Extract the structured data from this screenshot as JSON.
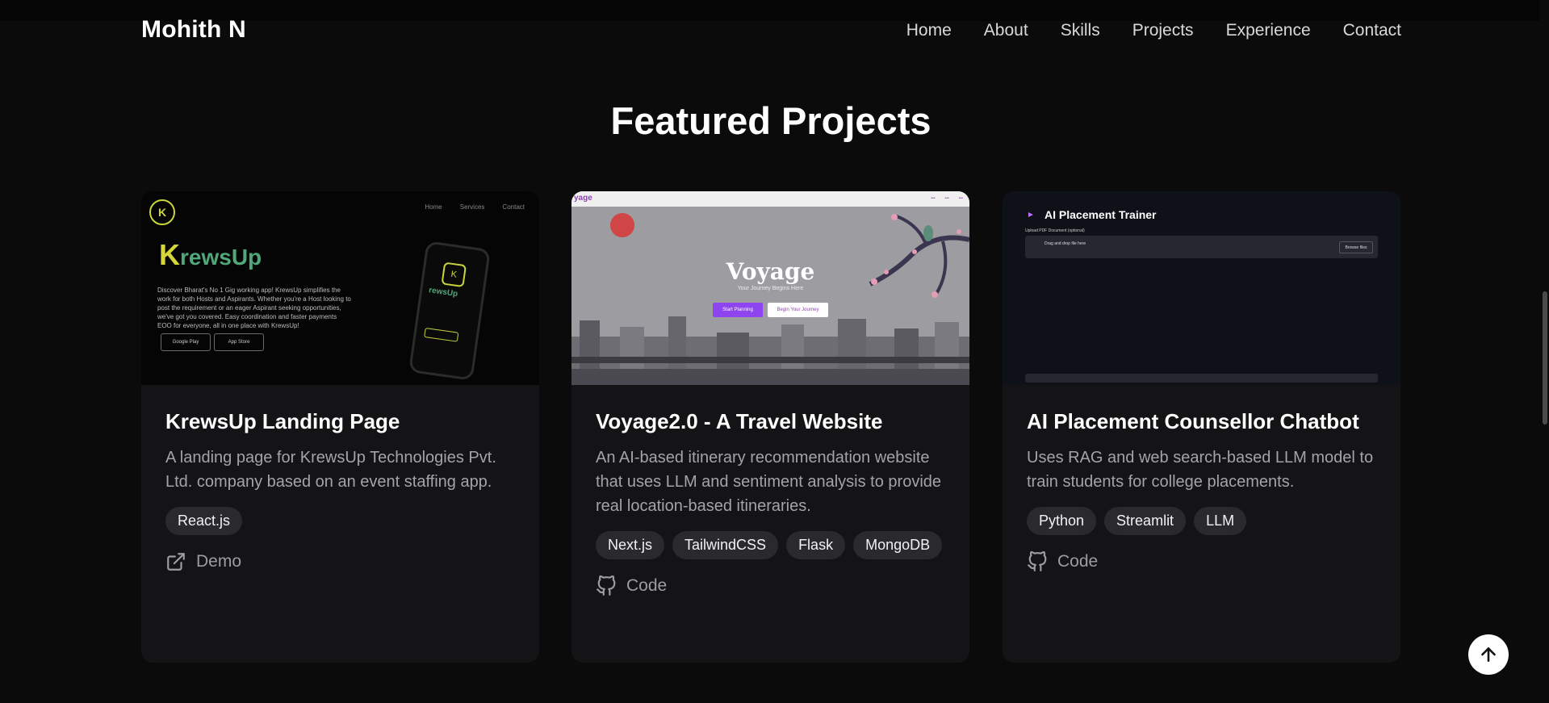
{
  "brand": "Mohith N",
  "nav": [
    "Home",
    "About",
    "Skills",
    "Projects",
    "Experience",
    "Contact"
  ],
  "section_title": "Featured Projects",
  "projects": [
    {
      "title": "KrewsUp Landing Page",
      "description": "A landing page for KrewsUp Technologies Pvt. Ltd. company based on an event staffing app.",
      "tags": [
        "React.js"
      ],
      "link_label": "Demo",
      "link_icon": "external-link-icon",
      "thumb": {
        "nav": [
          "Home",
          "Services",
          "Contact"
        ],
        "brand": "rewsUp",
        "text": "Discover Bharat's No 1 Gig working app! KrewsUp simplifies the work for both Hosts and Aspirants. Whether you're a Host looking to post the requirement or an eager Aspirant seeking opportunities, we've got you covered. Easy coordination and faster payments EOO for everyone, all in one place with KrewsUp!",
        "store1": "Google Play",
        "store2": "App Store"
      }
    },
    {
      "title": "Voyage2.0 - A Travel Website",
      "description": "An AI-based itinerary recommendation website that uses LLM and sentiment analysis to provide real location-based itineraries.",
      "tags": [
        "Next.js",
        "TailwindCSS",
        "Flask",
        "MongoDB"
      ],
      "link_label": "Code",
      "link_icon": "github-icon",
      "thumb": {
        "logo": "yage",
        "title": "Voyage",
        "subtitle": "Your Journey Begins Here",
        "btn1": "Start Planning",
        "btn2": "Begin Your Journey"
      }
    },
    {
      "title": "AI Placement Counsellor Chatbot",
      "description": "Uses RAG and web search-based LLM model to train students for college placements.",
      "tags": [
        "Python",
        "Streamlit",
        "LLM"
      ],
      "link_label": "Code",
      "link_icon": "github-icon",
      "thumb": {
        "title": "AI Placement Trainer",
        "upload_label": "Upload PDF Document (optional)",
        "drop_text": "Drag and drop file here",
        "browse": "Browse files"
      }
    }
  ],
  "colors": {
    "background": "#0b0b0c",
    "card": "#141416",
    "tag": "#2a2a2e",
    "muted": "#a3a3a9"
  }
}
